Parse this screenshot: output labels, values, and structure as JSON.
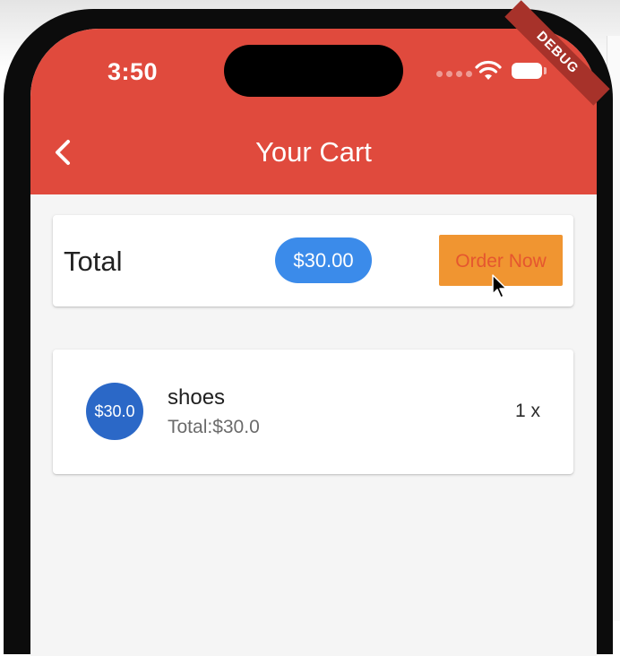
{
  "status_bar": {
    "time": "3:50"
  },
  "debug_banner": "DEBUG",
  "app_bar": {
    "title": "Your Cart"
  },
  "total_card": {
    "label": "Total",
    "amount": "$30.00",
    "order_button": "Order Now"
  },
  "cart_items": [
    {
      "avatar_price": "$30.0",
      "title": "shoes",
      "subtitle": "Total:$30.0",
      "quantity": "1 x"
    }
  ],
  "colors": {
    "app_bar": "#e04a3d",
    "chip": "#3b8bea",
    "order_button": "#f09531",
    "order_button_text": "#e5562f",
    "avatar": "#2b68c7"
  },
  "icons": [
    "back-arrow-icon",
    "wifi-icon",
    "battery-icon",
    "mouse-cursor-icon"
  ]
}
